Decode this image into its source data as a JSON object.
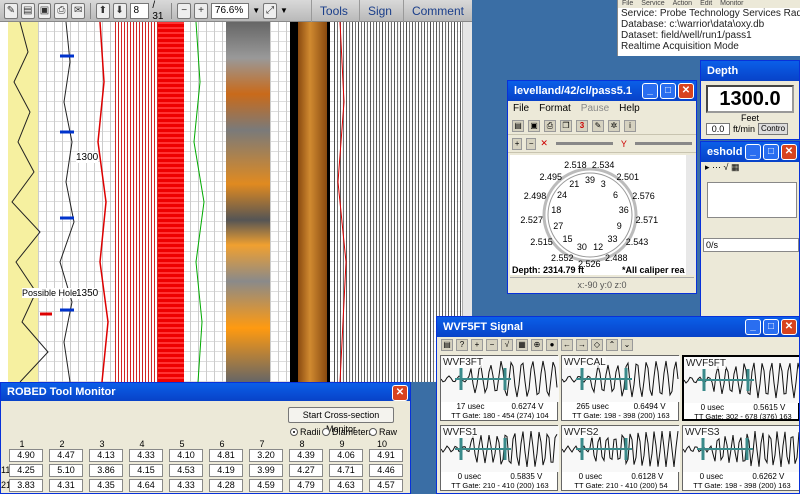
{
  "pdf": {
    "page_current": "8",
    "page_total": "/ 31",
    "zoom": "76.6%",
    "links": [
      "Tools",
      "Sign",
      "Comment"
    ],
    "depth_labels": [
      "1300",
      "1350"
    ],
    "annotation": "Possible Hole"
  },
  "info": {
    "menu": [
      "File",
      "Service",
      "Action",
      "Edit",
      "Monitor"
    ],
    "lines": [
      "Service:  Probe Technology Services Radi",
      "Database:  c:\\warrior\\data\\oxy.db",
      "Dataset:  field/well/run1/pass1",
      "Realtime Acquisition Mode"
    ]
  },
  "pass_window": {
    "title": "levelland/42/cl/pass5.1",
    "menu": [
      "File",
      "Format",
      "Pause",
      "Help"
    ],
    "depth": "Depth: 2314.79 ft",
    "note": "*All caliper rea",
    "status": "x:-90 y:0 z:0",
    "radii_values": [
      "2.518",
      "2.534",
      "2.501",
      "2.576",
      "2.571",
      "2.543",
      "2.488",
      "2.526",
      "2.552",
      "2.515",
      "2.527",
      "2.498",
      "2.495"
    ],
    "clock_numbers": [
      "39",
      "3",
      "6",
      "36",
      "9",
      "33",
      "12",
      "30",
      "15",
      "27",
      "18",
      "24",
      "21"
    ]
  },
  "depth_window": {
    "title": "Depth",
    "value": "1300.0",
    "unit": "Feet",
    "speed": "0.0",
    "speed_unit": "ft/min",
    "control": "Contro"
  },
  "thresh_window": {
    "title": "eshold",
    "field": "0/s"
  },
  "tool_monitor": {
    "title": "ROBED Tool Monitor",
    "start_button": "Start Cross-section Monitor",
    "radio_options": [
      "Radii",
      "Diameters",
      "Raw"
    ],
    "columns": [
      "1",
      "2",
      "3",
      "4",
      "5",
      "6",
      "7",
      "8",
      "9",
      "10"
    ],
    "rows": [
      {
        "label": "",
        "values": [
          "4.90",
          "4.47",
          "4.13",
          "4.33",
          "4.10",
          "4.81",
          "3.20",
          "4.39",
          "4.06",
          "4.91"
        ]
      },
      {
        "label": "11",
        "values": [
          "4.25",
          "5.10",
          "3.86",
          "4.15",
          "4.53",
          "4.19",
          "3.99",
          "4.27",
          "4.71",
          "4.46"
        ]
      },
      {
        "label": "21",
        "values": [
          "3.83",
          "4.31",
          "4.35",
          "4.64",
          "4.33",
          "4.28",
          "4.59",
          "4.79",
          "4.63",
          "4.57"
        ]
      }
    ]
  },
  "signal_window": {
    "title": "WVF5FT Signal",
    "panels": [
      {
        "name": "WVF3FT",
        "usec": "17 usec",
        "volt": "0.6274 V",
        "gate": "TT Gate: 180 - 454  (274) 104"
      },
      {
        "name": "WVFCAL",
        "usec": "265 usec",
        "volt": "0.6494 V",
        "gate": "TT Gate: 198 - 398  (200) 163"
      },
      {
        "name": "WVF5FT",
        "usec": "0 usec",
        "volt": "0.5615 V",
        "gate": "TT Gate: 302 - 678  (376) 163"
      },
      {
        "name": "WVFS1",
        "usec": "0 usec",
        "volt": "0.5835 V",
        "gate": "TT Gate: 210 - 410  (200) 163"
      },
      {
        "name": "WVFS2",
        "usec": "0 usec",
        "volt": "0.6128 V",
        "gate": "TT Gate: 210 - 410  (200) 54"
      },
      {
        "name": "WVFS3",
        "usec": "0 usec",
        "volt": "0.6262 V",
        "gate": "TT Gate: 198 - 398  (200) 163"
      }
    ]
  }
}
